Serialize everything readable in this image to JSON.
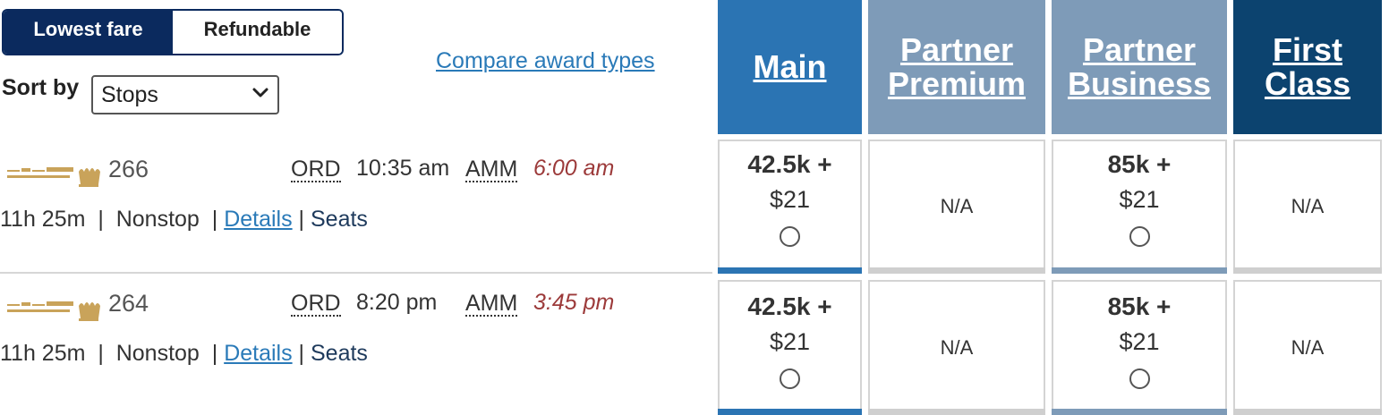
{
  "fare_toggle": {
    "lowest": "Lowest fare",
    "refundable": "Refundable"
  },
  "sort": {
    "label": "Sort by",
    "value": "Stops"
  },
  "compare_link": "Compare award types",
  "columns": [
    {
      "label_line1": "Main",
      "label_line2": "",
      "color": "#2b74b3"
    },
    {
      "label_line1": "Partner",
      "label_line2": "Premium",
      "color": "#7e9bb8"
    },
    {
      "label_line1": "Partner",
      "label_line2": "Business",
      "color": "#7e9bb8"
    },
    {
      "label_line1": "First",
      "label_line2": "Class",
      "color": "#0c436f"
    }
  ],
  "flights": [
    {
      "number": "266",
      "origin": "ORD",
      "depart": "10:35 am",
      "destination": "AMM",
      "arrive": "6:00 am",
      "duration": "11h 25m",
      "stops": "Nonstop",
      "details": "Details",
      "seats": "Seats",
      "fares": [
        {
          "miles": "42.5k +",
          "tax": "$21"
        },
        {
          "na": "N/A"
        },
        {
          "miles": "85k +",
          "tax": "$21"
        },
        {
          "na": "N/A"
        }
      ]
    },
    {
      "number": "264",
      "origin": "ORD",
      "depart": "8:20 pm",
      "destination": "AMM",
      "arrive": "3:45 pm",
      "duration": "11h 25m",
      "stops": "Nonstop",
      "details": "Details",
      "seats": "Seats",
      "fares": [
        {
          "miles": "42.5k +",
          "tax": "$21"
        },
        {
          "na": "N/A"
        },
        {
          "miles": "85k +",
          "tax": "$21"
        },
        {
          "na": "N/A"
        }
      ]
    }
  ],
  "airline_logo": "royal-jordanian-logo",
  "colors": {
    "brand_navy": "#0b2a5e",
    "link": "#2a7ab8",
    "arrival": "#9c3a3a"
  }
}
